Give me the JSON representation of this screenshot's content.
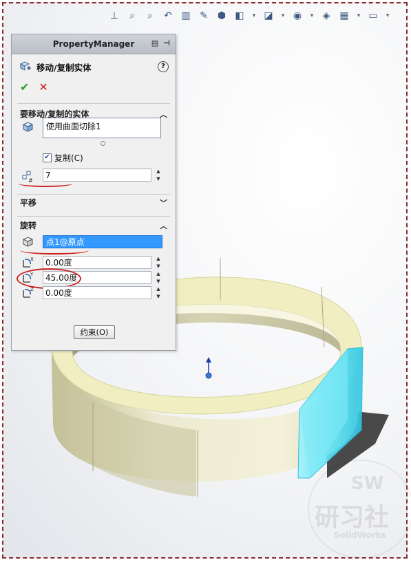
{
  "toolbar": {
    "icons": [
      "view-orientation-icon",
      "zoom-fit-icon",
      "zoom-area-icon",
      "previous-view-icon",
      "section-view-icon",
      "dynamic-annotation-icon",
      "view-orientation-cube-icon",
      "display-style-icon",
      "hide-show-icon",
      "edit-appearance-icon",
      "apply-scene-icon",
      "view-settings-icon"
    ]
  },
  "pm": {
    "title": "PropertyManager",
    "feature_name": "移动/复制实体",
    "help_label": "?",
    "ok_symbol": "✔",
    "cancel_symbol": "✕"
  },
  "bodies_section": {
    "title": "要移动/复制的实体",
    "selected_body": "使用曲面切除1",
    "copy_label": "复制(C)",
    "copy_checked": true,
    "copies_count": "7"
  },
  "translate_section": {
    "title": "平移"
  },
  "rotate_section": {
    "title": "旋转",
    "origin_point": "点1@原点",
    "x_angle": "0.00度",
    "y_angle": "45.00度",
    "z_angle": "0.00度"
  },
  "constraints_button": "约束(O)",
  "watermark": {
    "line1": "SW",
    "line2": "研习社",
    "line3": "SolidWorks"
  },
  "colors": {
    "selection_blue": "#3399ff",
    "ok_green": "#2c9a2c",
    "cancel_red": "#d21f1f",
    "ring_face": "#f2f0c4",
    "preview_cyan": "#5fe3f5"
  }
}
